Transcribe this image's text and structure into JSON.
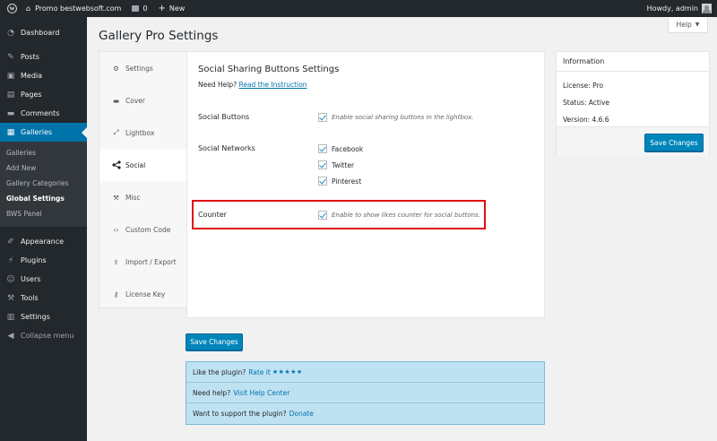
{
  "adminbar": {
    "site_name": "Promo bestwebsoft.com",
    "comments_count": "0",
    "new_label": "New",
    "howdy": "Howdy, admin"
  },
  "sidebar": {
    "items": [
      {
        "label": "Dashboard",
        "icon": "dashboard-icon"
      },
      {
        "label": "Posts",
        "icon": "pin-icon"
      },
      {
        "label": "Media",
        "icon": "media-icon"
      },
      {
        "label": "Pages",
        "icon": "pages-icon"
      },
      {
        "label": "Comments",
        "icon": "comments-icon"
      },
      {
        "label": "Galleries",
        "icon": "gallery-icon"
      }
    ],
    "submenu": [
      "Galleries",
      "Add New",
      "Gallery Categories",
      "Global Settings",
      "BWS Panel"
    ],
    "items_after": [
      {
        "label": "Appearance",
        "icon": "brush-icon"
      },
      {
        "label": "Plugins",
        "icon": "plugin-icon"
      },
      {
        "label": "Users",
        "icon": "users-icon"
      },
      {
        "label": "Tools",
        "icon": "wrench-icon"
      },
      {
        "label": "Settings",
        "icon": "settings-icon"
      },
      {
        "label": "Collapse menu",
        "icon": "collapse-icon"
      }
    ]
  },
  "page": {
    "title": "Gallery Pro Settings",
    "help_tab": "Help"
  },
  "tabs": [
    "Settings",
    "Cover",
    "Lightbox",
    "Social",
    "Misc",
    "Custom Code",
    "Import / Export",
    "License Key"
  ],
  "panel": {
    "heading": "Social Sharing Buttons Settings",
    "need_help": "Need Help?",
    "instruction_link": "Read the Instruction",
    "social_buttons_label": "Social Buttons",
    "social_buttons_desc": "Enable social sharing buttons in the lightbox.",
    "social_networks_label": "Social Networks",
    "networks": [
      "Facebook",
      "Twitter",
      "Pinterest"
    ],
    "counter_label": "Counter",
    "counter_desc": "Enable to show likes counter for social buttons."
  },
  "info": {
    "title": "Information",
    "license": "License: Pro",
    "status": "Status: Active",
    "version": "Version: 4.6.6",
    "save": "Save Changes"
  },
  "main_save": "Save Changes",
  "notices": {
    "like_text": "Like the plugin?",
    "rate_link": "Rate it",
    "stars": "★★★★★",
    "help_text": "Need help?",
    "help_link": "Visit Help Center",
    "support_text": "Want to support the plugin?",
    "donate_link": "Donate"
  },
  "colors": {
    "accent": "#0073aa",
    "sidebar_bg": "#23282d",
    "highlight_border": "#e01010",
    "notice_bg": "#bfe2f3"
  }
}
